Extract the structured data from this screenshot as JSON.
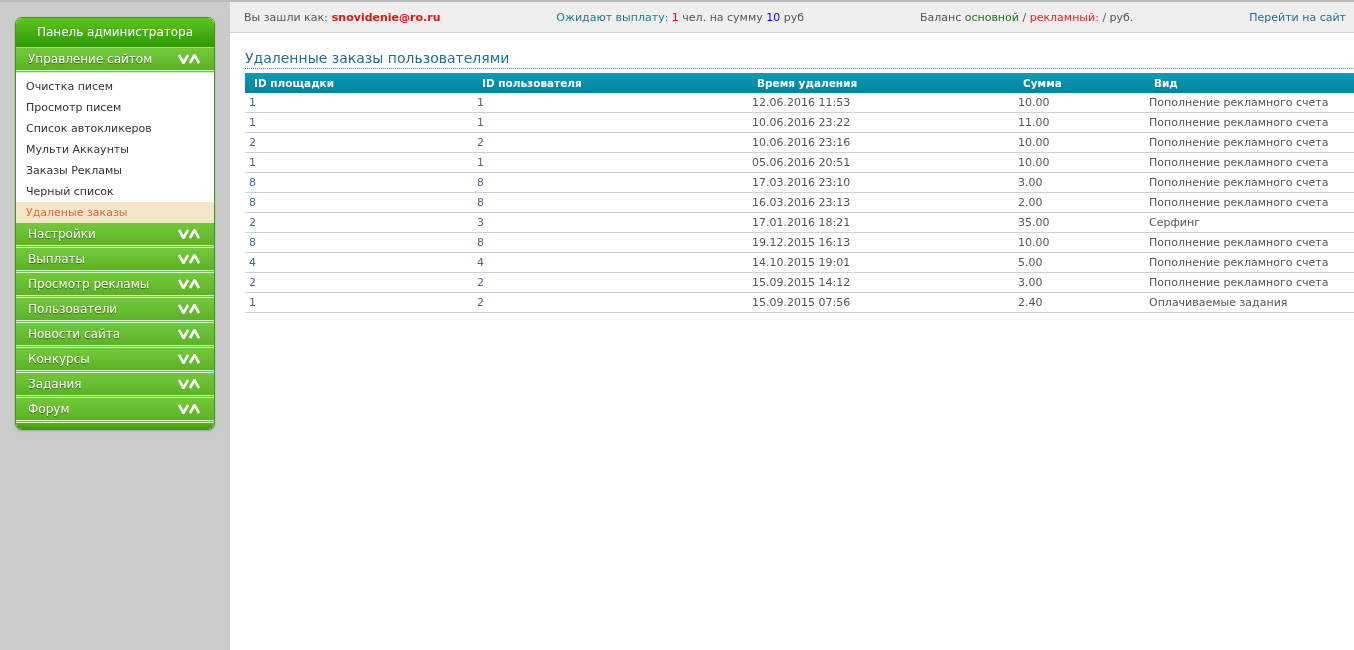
{
  "sidebar": {
    "title": "Панель администратора",
    "sections": [
      {
        "label": "Управление сайтом",
        "items": [
          {
            "label": "Очистка писем",
            "selected": false
          },
          {
            "label": "Просмотр писем",
            "selected": false
          },
          {
            "label": "Список автокликеров",
            "selected": false
          },
          {
            "label": "Мульти Аккаунты",
            "selected": false
          },
          {
            "label": "Заказы Рекламы",
            "selected": false
          },
          {
            "label": "Черный список",
            "selected": false
          },
          {
            "label": "Удаленые заказы",
            "selected": true
          }
        ]
      },
      {
        "label": "Настройки"
      },
      {
        "label": "Выплаты"
      },
      {
        "label": "Просмотр рекламы"
      },
      {
        "label": "Пользователи"
      },
      {
        "label": "Новости сайта"
      },
      {
        "label": "Конкурсы"
      },
      {
        "label": "Задания"
      },
      {
        "label": "Форум"
      }
    ]
  },
  "top_bar": {
    "login_label": "Вы зашли как:",
    "login_user": "snovidenie@ro.ru",
    "payouts": [
      {
        "text": "Ожидают выплату:",
        "color": "#1f7a9a"
      },
      {
        "text": "1",
        "color": "#ff0000"
      },
      {
        "text": "чел. на сумму"
      },
      {
        "text": "10",
        "color": "#0000ff"
      },
      {
        "text": "руб"
      }
    ],
    "balance": [
      {
        "text": "Баланс"
      },
      {
        "text": "основной",
        "color": "#1a7a1a"
      },
      {
        "text": "/"
      },
      {
        "text": "рекламный:",
        "color": "#ff1a1a"
      },
      {
        "text": "/ руб."
      }
    ],
    "site_link": "Перейти на сайт"
  },
  "page_title": "Удаленные заказы пользователями",
  "table": {
    "columns": [
      "ID площадки",
      "ID пользователя",
      "Время удаления",
      "Сумма",
      "Вид"
    ],
    "rows": [
      [
        "1",
        "1",
        "12.06.2016 11:53",
        "10.00",
        "Пополнение рекламного счета"
      ],
      [
        "1",
        "1",
        "10.06.2016 23:22",
        "11.00",
        "Пополнение рекламного счета"
      ],
      [
        "2",
        "2",
        "10.06.2016 23:16",
        "10.00",
        "Пополнение рекламного счета"
      ],
      [
        "1",
        "1",
        "05.06.2016 20:51",
        "10.00",
        "Пополнение рекламного счета"
      ],
      [
        "8",
        "8",
        "17.03.2016 23:10",
        "3.00",
        "Пополнение рекламного счета"
      ],
      [
        "8",
        "8",
        "16.03.2016 23:13",
        "2.00",
        "Пополнение рекламного счета"
      ],
      [
        "2",
        "3",
        "17.01.2016 18:21",
        "35.00",
        "Серфинг"
      ],
      [
        "8",
        "8",
        "19.12.2015 16:13",
        "10.00",
        "Пополнение рекламного счета"
      ],
      [
        "4",
        "4",
        "14.10.2015 19:01",
        "5.00",
        "Пополнение рекламного счета"
      ],
      [
        "2",
        "2",
        "15.09.2015 14:12",
        "3.00",
        "Пополнение рекламного счета"
      ],
      [
        "1",
        "2",
        "15.09.2015 07:56",
        "2.40",
        "Оплачиваемые задания"
      ]
    ]
  }
}
